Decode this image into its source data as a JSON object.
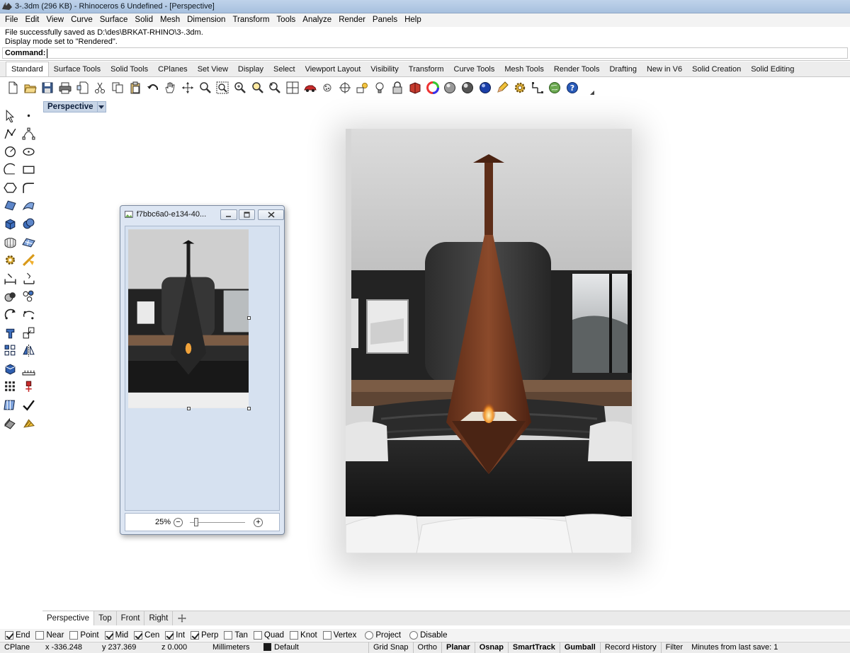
{
  "window": {
    "title": "3-.3dm (296 KB) - Rhinoceros 6 Undefined - [Perspective]"
  },
  "menu": [
    "File",
    "Edit",
    "View",
    "Curve",
    "Surface",
    "Solid",
    "Mesh",
    "Dimension",
    "Transform",
    "Tools",
    "Analyze",
    "Render",
    "Panels",
    "Help"
  ],
  "command_history": [
    "File successfully saved as D:\\des\\BRKAT-RHINO\\3-.3dm.",
    "Display mode set to \"Rendered\"."
  ],
  "command": {
    "label": "Command:",
    "value": ""
  },
  "toolbar_tabs": [
    "Standard",
    "Surface Tools",
    "Solid Tools",
    "CPlanes",
    "Set View",
    "Display",
    "Select",
    "Viewport Layout",
    "Visibility",
    "Transform",
    "Curve Tools",
    "Mesh Tools",
    "Render Tools",
    "Drafting",
    "New in V6",
    "Solid Creation",
    "Solid Editing"
  ],
  "active_toolbar_tab": "Standard",
  "toolbar_icons": [
    "new-file",
    "open-folder",
    "save",
    "print",
    "import",
    "cut",
    "copy",
    "paste",
    "undo",
    "pan-hand",
    "rotate-view",
    "zoom-dynamic",
    "zoom-window",
    "zoom-extents",
    "zoom-selected",
    "four-viewports",
    "car-render",
    "point-cloud",
    "target",
    "sun-sky",
    "lightbulb",
    "lock",
    "book-materials",
    "color-wheel",
    "shaded-sphere",
    "rendered-sphere",
    "blue-sphere",
    "pencil-highlight",
    "gear-options",
    "grid-snap",
    "globe",
    "help"
  ],
  "viewport": {
    "label": "Perspective"
  },
  "float_window": {
    "title": "f7bbc6a0-e134-40...",
    "zoom": "25%"
  },
  "viewport_tabs": [
    "Perspective",
    "Top",
    "Front",
    "Right"
  ],
  "osnaps": [
    {
      "label": "End",
      "checked": true
    },
    {
      "label": "Near",
      "checked": false
    },
    {
      "label": "Point",
      "checked": false
    },
    {
      "label": "Mid",
      "checked": true
    },
    {
      "label": "Cen",
      "checked": true
    },
    {
      "label": "Int",
      "checked": true
    },
    {
      "label": "Perp",
      "checked": true
    },
    {
      "label": "Tan",
      "checked": false
    },
    {
      "label": "Quad",
      "checked": false
    },
    {
      "label": "Knot",
      "checked": false
    },
    {
      "label": "Vertex",
      "checked": false
    },
    {
      "label": "Project",
      "checked": false,
      "round": true
    },
    {
      "label": "Disable",
      "checked": false,
      "round": true
    }
  ],
  "status": {
    "cplane": "CPlane",
    "x": "x -336.248",
    "y": "y 237.369",
    "z": "z 0.000",
    "units": "Millimeters",
    "layer": "Default",
    "grid_snap": "Grid Snap",
    "ortho": "Ortho",
    "planar": "Planar",
    "osnap": "Osnap",
    "smarttrack": "SmartTrack",
    "gumball": "Gumball",
    "record_history": "Record History",
    "filter": "Filter",
    "last_save": "Minutes from last save: 1"
  },
  "colors": {
    "title_bar": "#bfd3ea",
    "viewport_label": "#c8d5e6",
    "fireplace": "#7a3b22",
    "floor": "#1c1c1c"
  }
}
